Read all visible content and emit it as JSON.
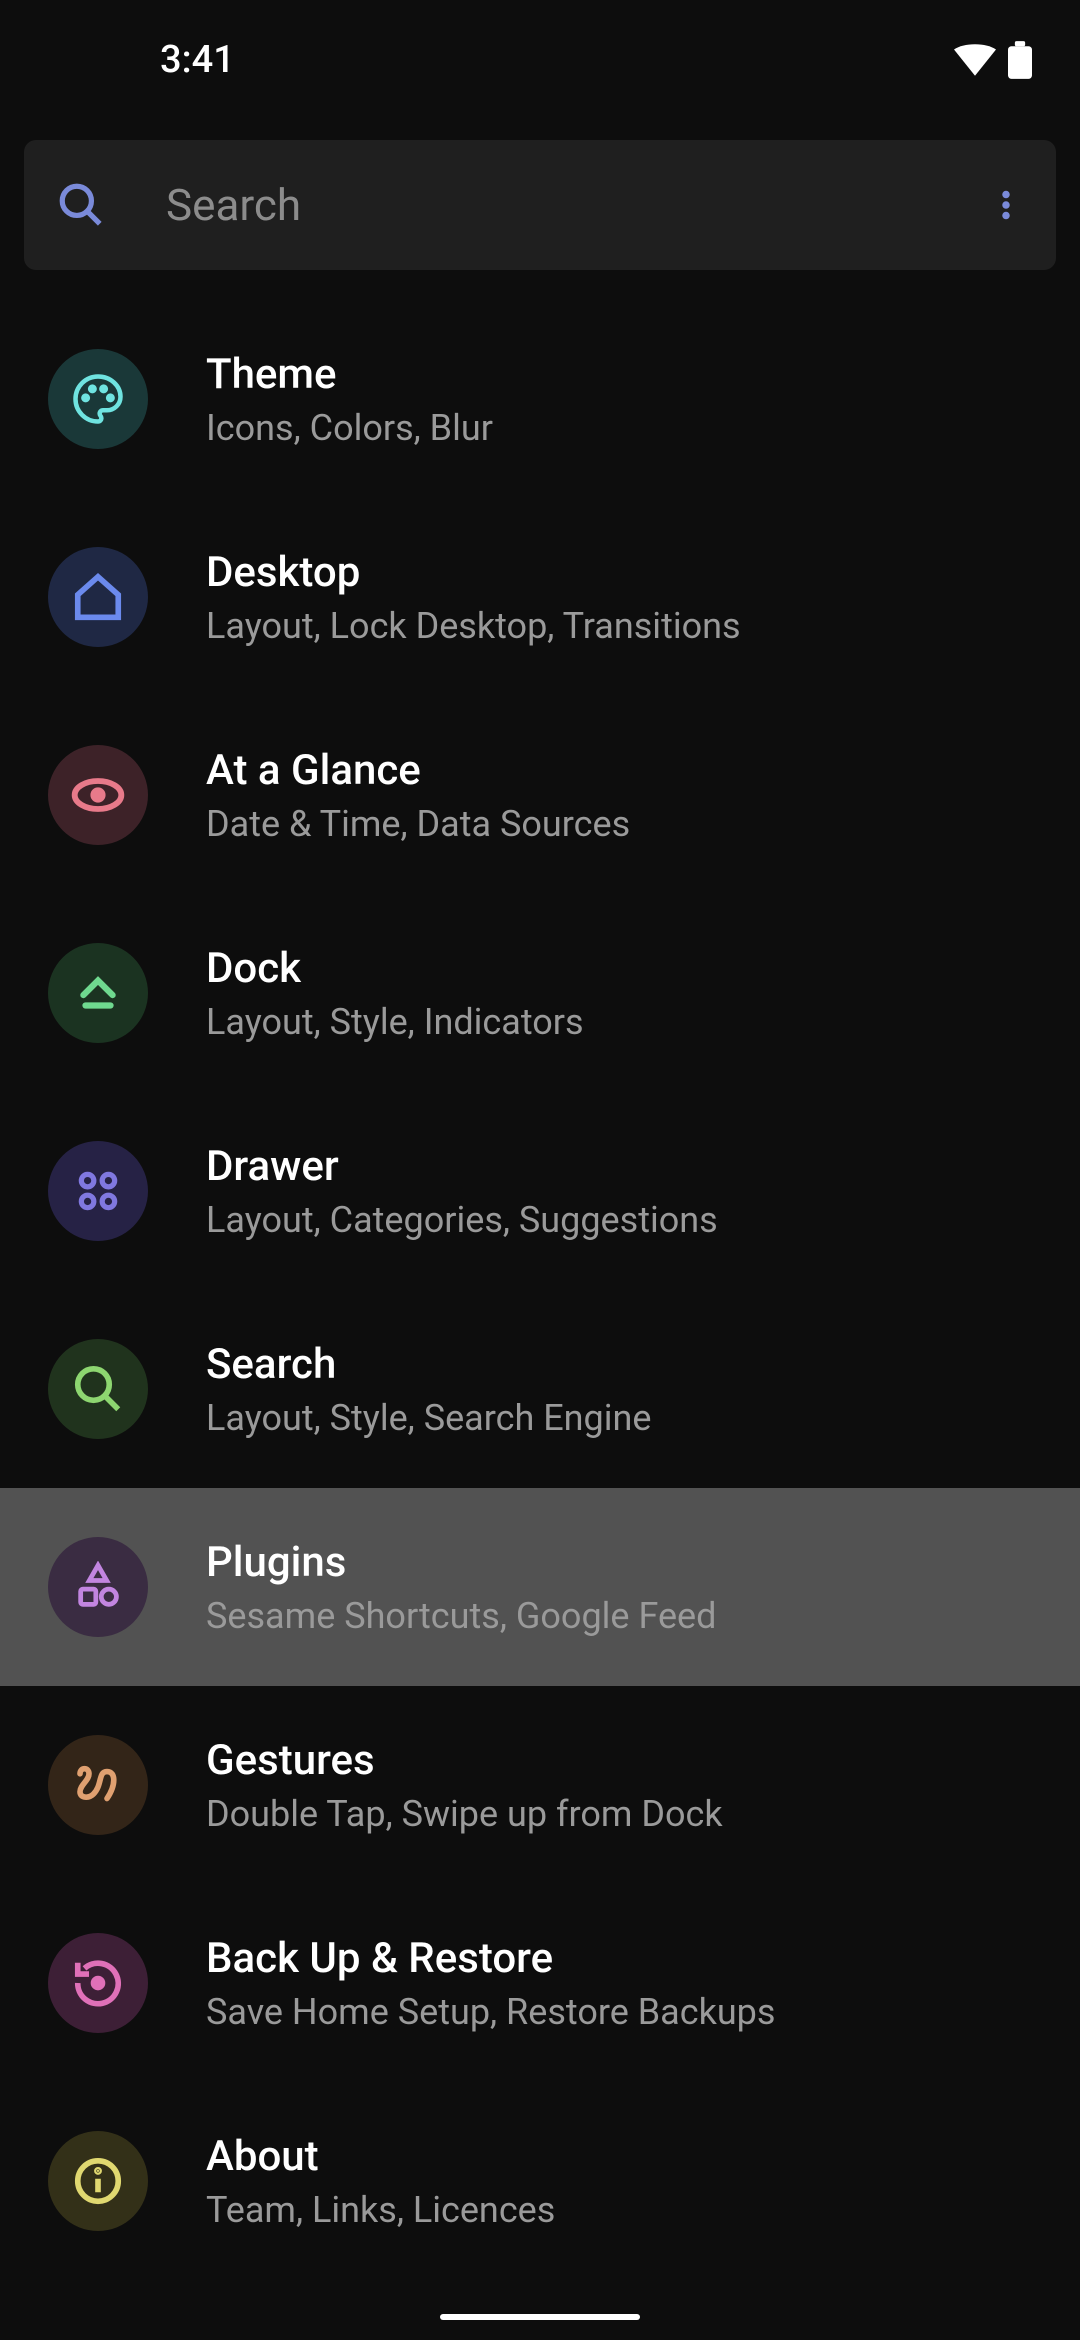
{
  "status": {
    "time": "3:41"
  },
  "search": {
    "placeholder": "Search"
  },
  "items": [
    {
      "title": "Theme",
      "subtitle": "Icons, Colors, Blur",
      "iconBg": "#1a3838",
      "iconName": "palette-icon",
      "iconColor": "#6fe3e0"
    },
    {
      "title": "Desktop",
      "subtitle": "Layout, Lock Desktop, Transitions",
      "iconBg": "#1f2844",
      "iconName": "home-icon",
      "iconColor": "#6b8aed"
    },
    {
      "title": "At a Glance",
      "subtitle": "Date & Time, Data Sources",
      "iconBg": "#3d2228",
      "iconName": "eye-icon",
      "iconColor": "#e87a8a"
    },
    {
      "title": "Dock",
      "subtitle": "Layout, Style, Indicators",
      "iconBg": "#1b3321",
      "iconName": "chevron-up-icon",
      "iconColor": "#6fd98f"
    },
    {
      "title": "Drawer",
      "subtitle": "Layout, Categories, Suggestions",
      "iconBg": "#262245",
      "iconName": "apps-icon",
      "iconColor": "#8078e0"
    },
    {
      "title": "Search",
      "subtitle": "Layout, Style, Search Engine",
      "iconBg": "#20331d",
      "iconName": "search-icon",
      "iconColor": "#8dd670"
    },
    {
      "title": "Plugins",
      "subtitle": "Sesame Shortcuts, Google Feed",
      "iconBg": "#3a2c42",
      "iconName": "shapes-icon",
      "iconColor": "#c285e0",
      "highlighted": true
    },
    {
      "title": "Gestures",
      "subtitle": "Double Tap, Swipe up from Dock",
      "iconBg": "#332518",
      "iconName": "gesture-icon",
      "iconColor": "#e0a070"
    },
    {
      "title": "Back Up & Restore",
      "subtitle": "Save Home Setup, Restore Backups",
      "iconBg": "#3d1f36",
      "iconName": "restore-icon",
      "iconColor": "#e070b8"
    },
    {
      "title": "About",
      "subtitle": "Team, Links, Licences",
      "iconBg": "#333018",
      "iconName": "info-icon",
      "iconColor": "#e0d870"
    }
  ]
}
